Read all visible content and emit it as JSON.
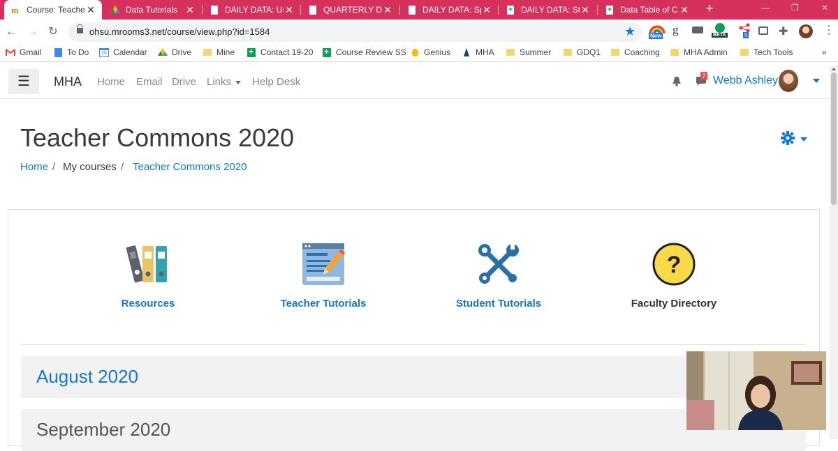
{
  "browser": {
    "tabs": [
      {
        "label": "Course: Teacher Commons",
        "icon": "moodle-icon",
        "active": true
      },
      {
        "label": "Data Tutorials",
        "icon": "drive-icon",
        "active": false
      },
      {
        "label": "DAILY DATA: Usage",
        "icon": "docs-icon",
        "active": false
      },
      {
        "label": "QUARTERLY DATA",
        "icon": "docs-icon",
        "active": false
      },
      {
        "label": "DAILY DATA: Sp",
        "icon": "docs-icon",
        "active": false
      },
      {
        "label": "DAILY DATA: Stu",
        "icon": "sheets-icon",
        "active": false
      },
      {
        "label": "Data Table of C",
        "icon": "sheets-icon",
        "active": false
      }
    ],
    "url": "ohsu.mrooms3.net/course/view.php?id=1584",
    "extension_labels": {
      "new": "New",
      "beta": "BETA",
      "count": "5"
    },
    "bookmarks": [
      {
        "label": "Gmail",
        "icon": "gmail-icon"
      },
      {
        "label": "To Do",
        "icon": "docs-icon"
      },
      {
        "label": "Calendar",
        "icon": "calendar-icon",
        "day": "26"
      },
      {
        "label": "Drive",
        "icon": "drive-icon"
      },
      {
        "label": "Mine",
        "icon": "folder-icon"
      },
      {
        "label": "Contact 19-20",
        "icon": "sheets-icon"
      },
      {
        "label": "Course Review SS",
        "icon": "sheets-icon"
      },
      {
        "label": "Genius",
        "icon": "lightbulb-icon"
      },
      {
        "label": "MHA",
        "icon": "tree-icon"
      },
      {
        "label": "Summer",
        "icon": "folder-icon"
      },
      {
        "label": "GDQ1",
        "icon": "folder-icon"
      },
      {
        "label": "Coaching",
        "icon": "folder-icon"
      },
      {
        "label": "MHA Admin",
        "icon": "folder-icon"
      },
      {
        "label": "Tech Tools",
        "icon": "folder-icon"
      }
    ],
    "overflow": "»"
  },
  "nav": {
    "brand": "MHA",
    "links": [
      "Home",
      "Email",
      "Drive",
      "Links",
      "Help Desk"
    ],
    "notification_count": "7",
    "user_name": "Webb Ashley"
  },
  "page": {
    "title": "Teacher Commons 2020",
    "breadcrumb": [
      "Home",
      "My courses",
      "Teacher Commons 2020"
    ],
    "breadcrumb_sep": "/"
  },
  "tiles": [
    {
      "label": "Resources",
      "icon": "binders-icon"
    },
    {
      "label": "Teacher Tutorials",
      "icon": "document-pencil-icon"
    },
    {
      "label": "Student Tutorials",
      "icon": "tools-icon"
    },
    {
      "label": "Faculty Directory",
      "icon": "question-mark-icon"
    }
  ],
  "sections": [
    "August 2020",
    "September 2020"
  ],
  "colors": {
    "tab_strip": "#d6305c",
    "link": "#1177d1",
    "tile_teal": "#34a1b0"
  }
}
